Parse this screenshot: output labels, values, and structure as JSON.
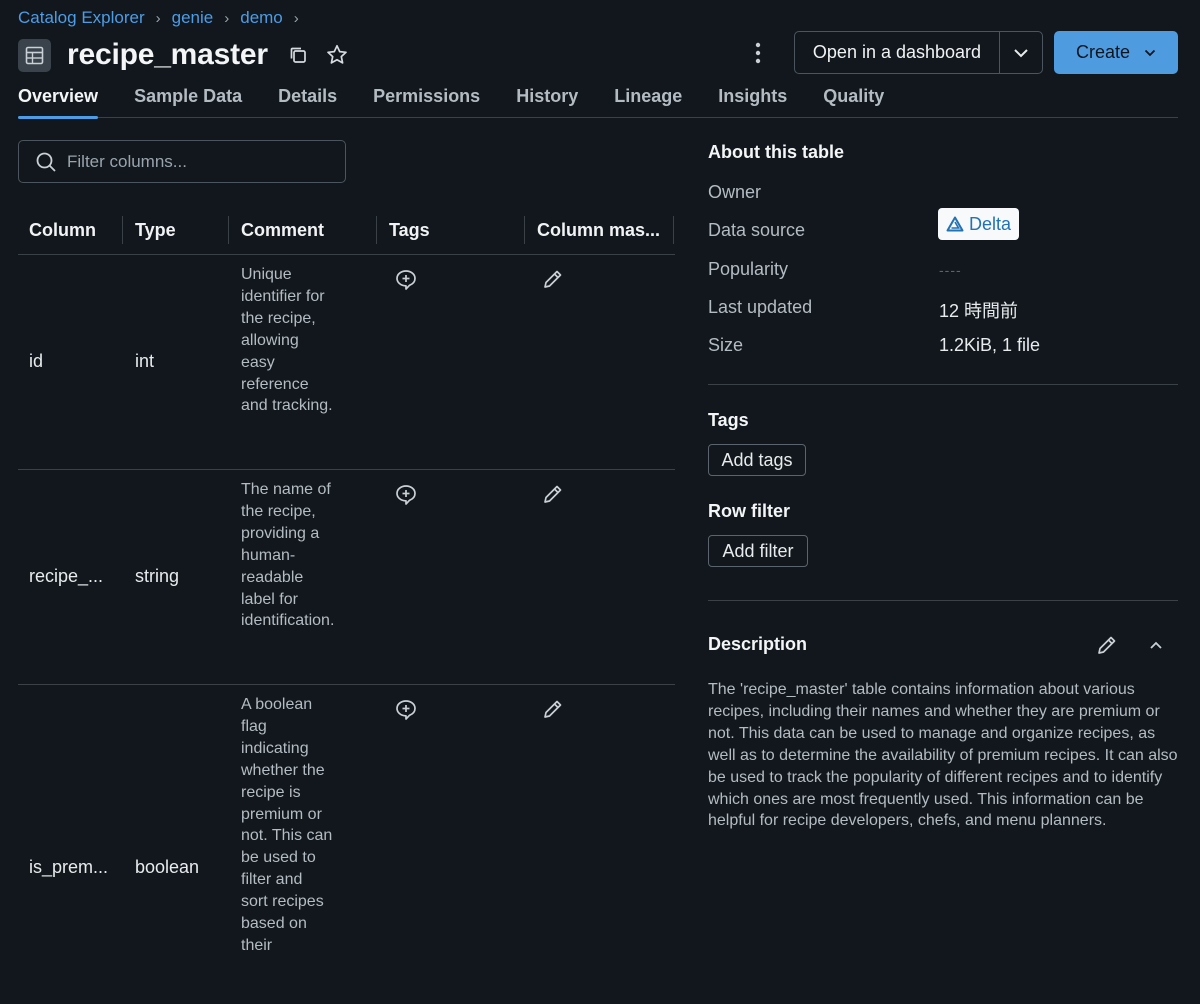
{
  "breadcrumb": [
    "Catalog Explorer",
    "genie",
    "demo"
  ],
  "title": "recipe_master",
  "actions": {
    "dashboard_label": "Open in a dashboard",
    "create_label": "Create"
  },
  "tabs": [
    "Overview",
    "Sample Data",
    "Details",
    "Permissions",
    "History",
    "Lineage",
    "Insights",
    "Quality"
  ],
  "active_tab": "Overview",
  "filter": {
    "placeholder": "Filter columns..."
  },
  "table": {
    "headers": [
      "Column",
      "Type",
      "Comment",
      "Tags",
      "Column mas..."
    ],
    "rows": [
      {
        "name": "id",
        "type": "int",
        "comment": "Unique identifier for the recipe, allowing easy reference and tracking."
      },
      {
        "name": "recipe_...",
        "type": "string",
        "comment": "The name of the recipe, providing a human-readable label for identification."
      },
      {
        "name": "is_prem...",
        "type": "boolean",
        "comment": "A boolean flag indicating whether the recipe is premium or not. This can be used to filter and sort recipes based on their"
      }
    ]
  },
  "about": {
    "heading": "About this table",
    "owner_label": "Owner",
    "data_source_label": "Data source",
    "data_source_value": "Delta",
    "popularity_label": "Popularity",
    "popularity_value": "----",
    "last_updated_label": "Last updated",
    "last_updated_value": "12 時間前",
    "size_label": "Size",
    "size_value": "1.2KiB, 1 file"
  },
  "tags": {
    "heading": "Tags",
    "button": "Add tags"
  },
  "row_filter": {
    "heading": "Row filter",
    "button": "Add filter"
  },
  "description": {
    "heading": "Description",
    "text": "The 'recipe_master' table contains information about various recipes, including their names and whether they are premium or not. This data can be used to manage and organize recipes, as well as to determine the availability of premium recipes. It can also be used to track the popularity of different recipes and to identify which ones are most frequently used. This information can be helpful for recipe developers, chefs, and menu planners."
  },
  "colors": {
    "accent": "#4c9ce6",
    "create_bg": "#4f9be0",
    "background": "#11171c"
  }
}
